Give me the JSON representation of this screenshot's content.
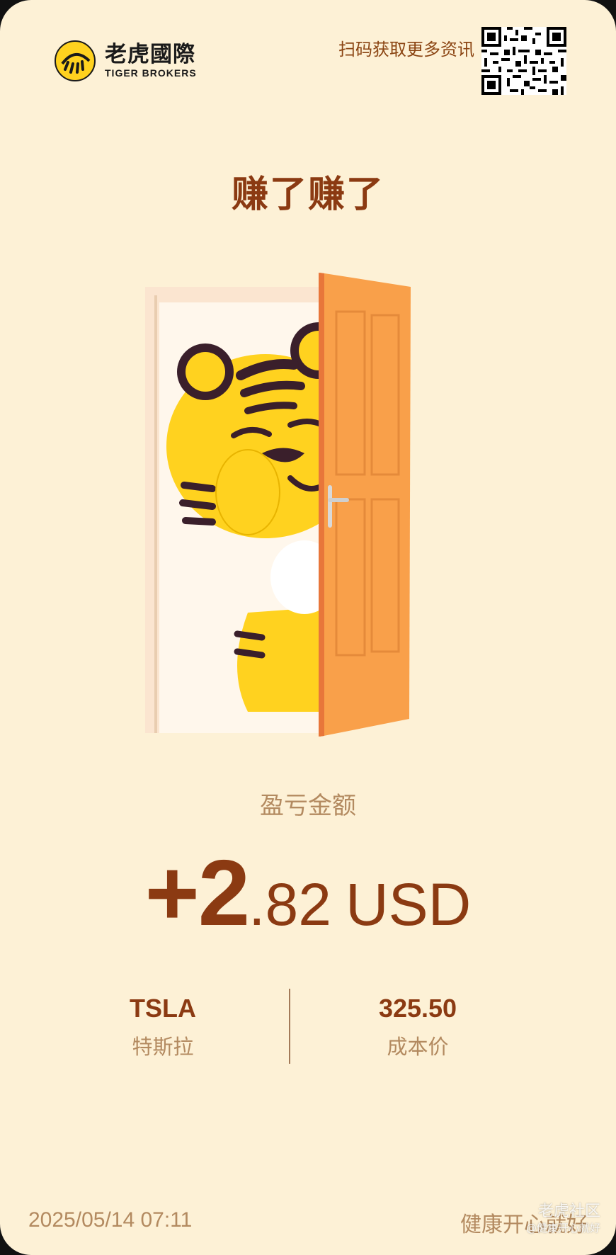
{
  "brand": {
    "name_cn": "老虎國際",
    "name_en": "TIGER BROKERS"
  },
  "header": {
    "scan_text": "扫码获取更多资讯"
  },
  "headline": "赚了赚了",
  "pnl": {
    "label": "盈亏金额",
    "amount_int": "+2",
    "amount_dec": ".82",
    "currency": "USD"
  },
  "stock": {
    "symbol": "TSLA",
    "name": "特斯拉",
    "cost_price": "325.50",
    "cost_label": "成本价"
  },
  "footer": {
    "timestamp": "2025/05/14 07:11",
    "nickname": "健康开心就好"
  },
  "watermark": {
    "title": "老虎社区",
    "handle": "@健康开心就好"
  },
  "colors": {
    "background": "#fdf1d6",
    "primary_text": "#8b3a12",
    "secondary_text": "#b38a60",
    "tiger_yellow": "#ffd21f",
    "door_orange": "#f9a04a"
  }
}
